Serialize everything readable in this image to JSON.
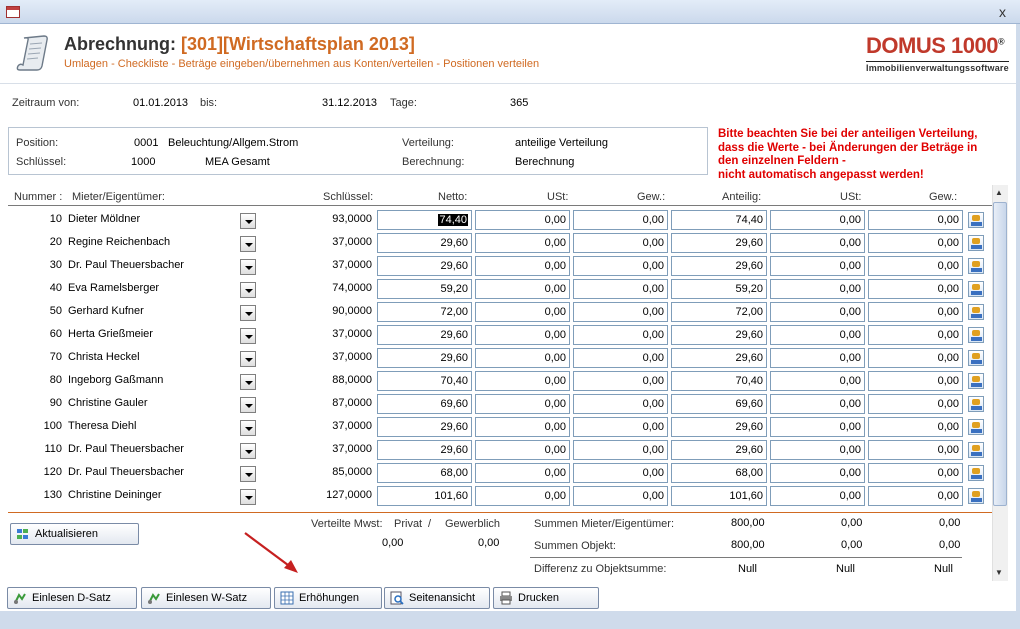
{
  "window": {
    "close_label": "x"
  },
  "header": {
    "title_prefix": "Abrechnung:",
    "title_code": "[301][Wirtschaftsplan 2013]",
    "subtitle": "Umlagen - Checkliste - Beträge eingeben/übernehmen aus Konten/verteilen - Positionen verteilen",
    "logo_main": "DOMUS 1000",
    "logo_reg": "®",
    "logo_sub": "Immobilienverwaltungssoftware"
  },
  "period": {
    "from_label": "Zeitraum von:",
    "from": "01.01.2013",
    "to_label": "bis:",
    "to": "31.12.2013",
    "days_label": "Tage:",
    "days": "365"
  },
  "position": {
    "pos_label": "Position:",
    "pos_code": "0001",
    "pos_name": "Beleuchtung/Allgem.Strom",
    "key_label": "Schlüssel:",
    "key_code": "1000",
    "key_name": "MEA Gesamt",
    "dist_label": "Verteilung:",
    "dist_value": "anteilige Verteilung",
    "calc_label": "Berechnung:",
    "calc_value": "Berechnung"
  },
  "warning": {
    "line1": "Bitte beachten Sie bei der anteiligen Verteilung,",
    "line2": "dass die Werte - bei Änderungen der Beträge in",
    "line3": "den einzelnen Feldern -",
    "line4": "nicht automatisch angepasst werden!"
  },
  "columns": {
    "nummer": "Nummer :",
    "mieter": "Mieter/Eigentümer:",
    "schluessel": "Schlüssel:",
    "netto": "Netto:",
    "ust": "USt:",
    "gew": "Gew.:",
    "anteilig": "Anteilig:",
    "ust2": "USt:",
    "gew2": "Gew.:"
  },
  "rows": [
    {
      "nr": "10",
      "name": "Dieter Möldner",
      "key": "93,0000",
      "netto": "74,40",
      "ust": "0,00",
      "gew": "0,00",
      "ant": "74,40",
      "ust2": "0,00",
      "gew2": "0,00"
    },
    {
      "nr": "20",
      "name": "Regine Reichenbach",
      "key": "37,0000",
      "netto": "29,60",
      "ust": "0,00",
      "gew": "0,00",
      "ant": "29,60",
      "ust2": "0,00",
      "gew2": "0,00"
    },
    {
      "nr": "30",
      "name": "Dr. Paul Theuersbacher",
      "key": "37,0000",
      "netto": "29,60",
      "ust": "0,00",
      "gew": "0,00",
      "ant": "29,60",
      "ust2": "0,00",
      "gew2": "0,00"
    },
    {
      "nr": "40",
      "name": "Eva Ramelsberger",
      "key": "74,0000",
      "netto": "59,20",
      "ust": "0,00",
      "gew": "0,00",
      "ant": "59,20",
      "ust2": "0,00",
      "gew2": "0,00"
    },
    {
      "nr": "50",
      "name": "Gerhard Kufner",
      "key": "90,0000",
      "netto": "72,00",
      "ust": "0,00",
      "gew": "0,00",
      "ant": "72,00",
      "ust2": "0,00",
      "gew2": "0,00"
    },
    {
      "nr": "60",
      "name": "Herta Grießmeier",
      "key": "37,0000",
      "netto": "29,60",
      "ust": "0,00",
      "gew": "0,00",
      "ant": "29,60",
      "ust2": "0,00",
      "gew2": "0,00"
    },
    {
      "nr": "70",
      "name": "Christa Heckel",
      "key": "37,0000",
      "netto": "29,60",
      "ust": "0,00",
      "gew": "0,00",
      "ant": "29,60",
      "ust2": "0,00",
      "gew2": "0,00"
    },
    {
      "nr": "80",
      "name": "Ingeborg Gaßmann",
      "key": "88,0000",
      "netto": "70,40",
      "ust": "0,00",
      "gew": "0,00",
      "ant": "70,40",
      "ust2": "0,00",
      "gew2": "0,00"
    },
    {
      "nr": "90",
      "name": "Christine Gauler",
      "key": "87,0000",
      "netto": "69,60",
      "ust": "0,00",
      "gew": "0,00",
      "ant": "69,60",
      "ust2": "0,00",
      "gew2": "0,00"
    },
    {
      "nr": "100",
      "name": "Theresa Diehl",
      "key": "37,0000",
      "netto": "29,60",
      "ust": "0,00",
      "gew": "0,00",
      "ant": "29,60",
      "ust2": "0,00",
      "gew2": "0,00"
    },
    {
      "nr": "110",
      "name": "Dr. Paul Theuersbacher",
      "key": "37,0000",
      "netto": "29,60",
      "ust": "0,00",
      "gew": "0,00",
      "ant": "29,60",
      "ust2": "0,00",
      "gew2": "0,00"
    },
    {
      "nr": "120",
      "name": "Dr. Paul Theuersbacher",
      "key": "85,0000",
      "netto": "68,00",
      "ust": "0,00",
      "gew": "0,00",
      "ant": "68,00",
      "ust2": "0,00",
      "gew2": "0,00"
    },
    {
      "nr": "130",
      "name": "Christine Deininger",
      "key": "127,0000",
      "netto": "101,60",
      "ust": "0,00",
      "gew": "0,00",
      "ant": "101,60",
      "ust2": "0,00",
      "gew2": "0,00"
    }
  ],
  "footer": {
    "refresh_label": "Aktualisieren",
    "mwst_label": "Verteilte Mwst:",
    "privat_label": "Privat",
    "slash": "/",
    "gewerblich_label": "Gewerblich",
    "privat_value": "0,00",
    "gewerblich_value": "0,00",
    "sum_tenant_label": "Summen Mieter/Eigentümer:",
    "sum_tenant": [
      "800,00",
      "0,00",
      "0,00"
    ],
    "sum_object_label": "Summen Objekt:",
    "sum_object": [
      "800,00",
      "0,00",
      "0,00"
    ],
    "diff_label": "Differenz zu Objektsumme:",
    "diff": [
      "Null",
      "Null",
      "Null"
    ]
  },
  "buttons": {
    "d_satz": "Einlesen D-Satz",
    "w_satz": "Einlesen W-Satz",
    "erhoehungen": "Erhöhungen",
    "seitenansicht": "Seitenansicht",
    "drucken": "Drucken"
  },
  "colors": {
    "accent": "#d06a22",
    "warning": "#e00000",
    "logo_red": "#c0392b"
  }
}
